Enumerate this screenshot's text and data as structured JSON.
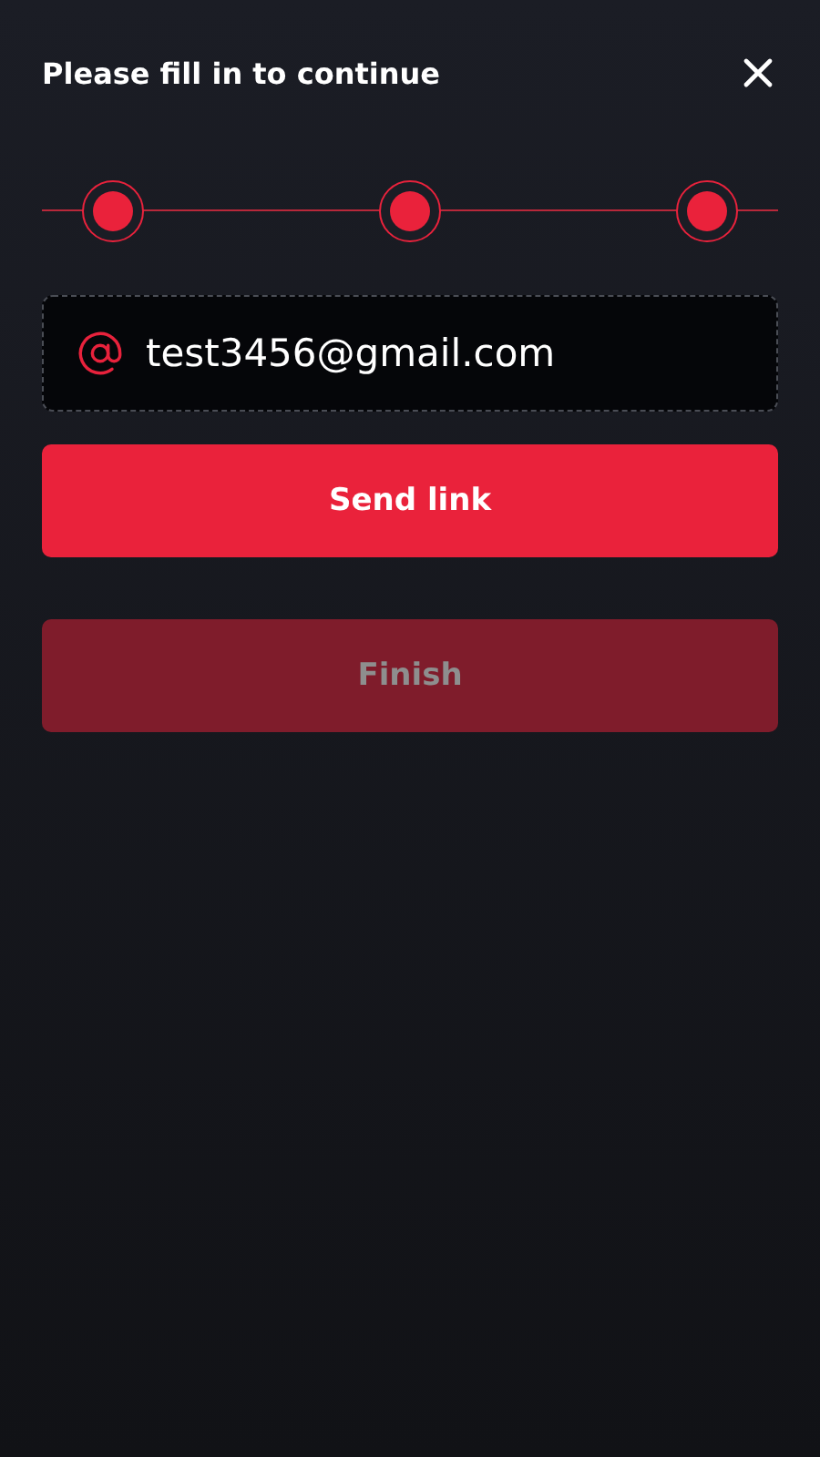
{
  "header": {
    "title": "Please fill in to continue"
  },
  "steps": [
    {
      "completed": true
    },
    {
      "completed": true
    },
    {
      "completed": true
    }
  ],
  "email_field": {
    "value": "test3456@gmail.com"
  },
  "buttons": [
    {
      "label": "Send link",
      "disabled": false
    },
    {
      "label": "Finish",
      "disabled": true
    }
  ]
}
